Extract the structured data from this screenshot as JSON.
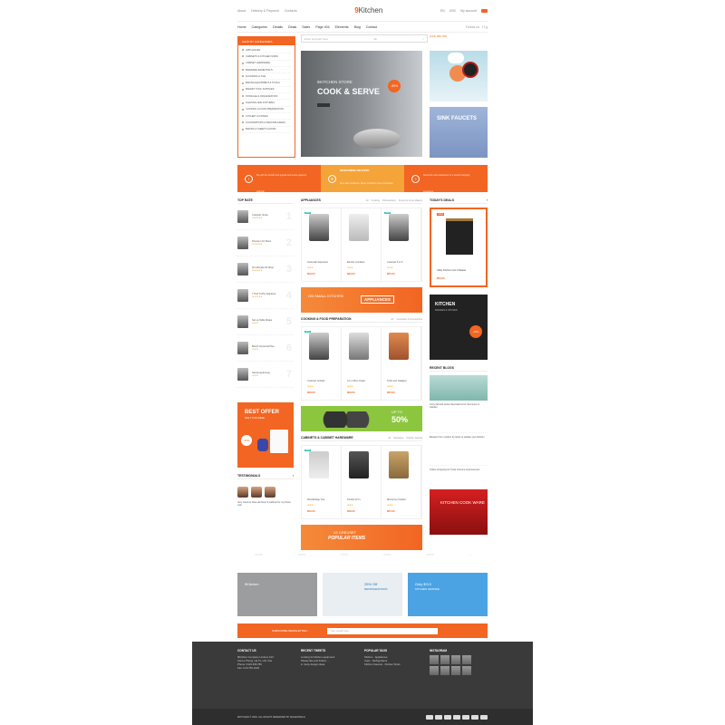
{
  "topbar": {
    "links": [
      "About",
      "Delivery & Payment",
      "Contacts"
    ],
    "logo_num": "9",
    "logo_text": "Kitchen",
    "lang": "EN",
    "currency": "USD",
    "account": "My account"
  },
  "nav": {
    "items": [
      "Home",
      "Categories",
      "Details",
      "Deals",
      "Sales",
      "Page 404",
      "Elements",
      "Blog",
      "Contact"
    ],
    "follow": "Follow us"
  },
  "categories": {
    "title": "SHOP BY CATEGORIES",
    "items": [
      "APPLIANCES",
      "CABINETS & KITCHEN SINKS",
      "CABINET HARDWARE",
      "BARWARE ESSENTIALS",
      "FLOORING & TILE",
      "BAKING EQUIPMENT & TOOLS",
      "BAKERY TOOL SUPPLIES",
      "STORAGE & ORGANIZATION",
      "LIGHTING AND FIXTURES",
      "COOKING & FOOD PREPARATION",
      "CUTLERY & KNIVES",
      "COUNTERTOPS & BACKSPLASHES",
      "BAKING & SHEETS & PANS"
    ]
  },
  "search": {
    "placeholder": "Enter keyword here",
    "scope": "All"
  },
  "phone": "(123) 456 789",
  "hero": {
    "store": "9KITCHEN STORE",
    "headline": "COOK & SERVE",
    "discount": "-30%"
  },
  "side_banner": {
    "title": "SINK FAUCETS"
  },
  "features": [
    {
      "title": "SAVE ON PRICE",
      "text": "Pay with the worlds most popular and secure payment methods",
      "icon": "!"
    },
    {
      "title": "WORLDWIDE DELIVERY",
      "text": "Shop with confidence. Buyer protection covers purchases",
      "icon": "✈"
    },
    {
      "title": "24/7 HELP CENTER",
      "text": "Round the clock assistance for a smooth shopping experience",
      "icon": "?"
    }
  ],
  "top_rate": {
    "title": "TOP RATE",
    "items": [
      {
        "name": "Cuisinart Versa",
        "num": "1"
      },
      {
        "name": "Premium 10 Piece",
        "num": "2"
      },
      {
        "name": "Tel Ultimate 62 Shop",
        "num": "3"
      },
      {
        "name": "7 Tool Tri-Ply Stainless",
        "num": "4"
      },
      {
        "name": "Set up Table Mates",
        "num": "5"
      },
      {
        "name": "Bosch Universal Plus",
        "num": "6"
      },
      {
        "name": "Samsung Energy",
        "num": "7"
      }
    ]
  },
  "appliances": {
    "title": "APPLIANCES",
    "tabs": [
      "All",
      "Cooking",
      "Dishwashers",
      "Freezers & Ice Makers"
    ],
    "items": [
      {
        "name": "Automatic Espresso",
        "price": "$59.00"
      },
      {
        "name": "Electric Cordless",
        "price": "$60.00"
      },
      {
        "name": "Cuisinart 6 in 6",
        "price": "$55.00"
      }
    ]
  },
  "banner_appliances": {
    "line": "ON SMALL KITCHEN",
    "label": "APPLIANCES"
  },
  "cooking": {
    "title": "COOKING & FOOD PREPARATION",
    "tabs": [
      "All",
      "Cookware & Accessories"
    ],
    "items": [
      {
        "name": "Cuisinart Grinder",
        "price": "$58.00"
      },
      {
        "name": "4-In-1 Box Grater",
        "price": "$59.00"
      },
      {
        "name": "Tools and Gadgets",
        "price": "$55.00"
      }
    ]
  },
  "banner_50": {
    "line": "UP TO",
    "value": "50%"
  },
  "cabinets": {
    "title": "CABINETS & CABINET HARDWARE",
    "tabs": [
      "All",
      "Hardware",
      "Kitchen Islands"
    ],
    "items": [
      {
        "name": "Woodbridge Two",
        "price": "$50.00"
      },
      {
        "name": "Kimble 42 In.",
        "price": "$58.00"
      },
      {
        "name": "Monterrey Kitchen",
        "price": "$55.00"
      }
    ]
  },
  "banner_le": {
    "line": "LE CREUSET",
    "label": "POPULAR ITEMS"
  },
  "deals": {
    "title": "TODAY'S DEALS",
    "sale": "SALE",
    "name": "Utility Kitchen Cart 4 Basket",
    "price": "$55.00"
  },
  "range": {
    "title": "KITCHEN",
    "sub": "RANGES & STOVES",
    "off": "-15%"
  },
  "blogs": {
    "title": "RECENT BLOGS",
    "items": [
      "Cozy fall and winter decorations for the Home & Garden",
      "Beware from modern fly tactic to update your kitchen",
      "Online shopping for Tools & Home Improvement"
    ]
  },
  "best_offer": {
    "title": "BEST OFFER",
    "sub": "DAILY THIS WEEK",
    "off": "-50%"
  },
  "testimonials": {
    "title": "TESTIMONIALS",
    "quote": "Very Good to have all these 9 Cabinet for my future use!"
  },
  "cookware": {
    "title": "KITCHEN COOK WARE"
  },
  "triple": [
    {
      "title": "9Kitchen",
      "sub": "",
      "color": "#9b9d9f"
    },
    {
      "title": "25% Off",
      "sub": "REFRIGERATORS",
      "color": "#e8eef2"
    },
    {
      "title": "Only $'9.0",
      "sub": "KITCHEN GRANDE",
      "color": "#4ba3e3"
    }
  ],
  "subscribe": {
    "label": "SUBSCRIBE NEWSLETTER...",
    "placeholder": "Your email here"
  },
  "footer": {
    "contact": {
      "title": "CONTACT US",
      "lines": [
        "9Kitchen Company Limited, 123",
        "Cat Le Phong, Ha Tu, HN, Viet",
        "Phone: 0123.456.789",
        "Fax: 0.34.781.2222"
      ]
    },
    "tweets": {
      "title": "RECENT TWEETS",
      "lines": [
        "Looking for kitchen equipment",
        "Please like and Follow: ...",
        "in many design ideas"
      ]
    },
    "tags": {
      "title": "POPULAR TAGS",
      "lines": [
        "Kitchen",
        "Appliances",
        "Cups",
        "Refrigerators",
        "Kitchen Faucets",
        "Kitchen Sinks"
      ]
    },
    "instagram": {
      "title": "INSTAGRAM"
    },
    "copyright": "9KITCHEN © 2016. ALL RIGHTS RESERVED BY MAGENTECH"
  },
  "colors": {
    "accent": "#f26522",
    "green": "#8cc63f",
    "dark": "#3a3a3a"
  }
}
